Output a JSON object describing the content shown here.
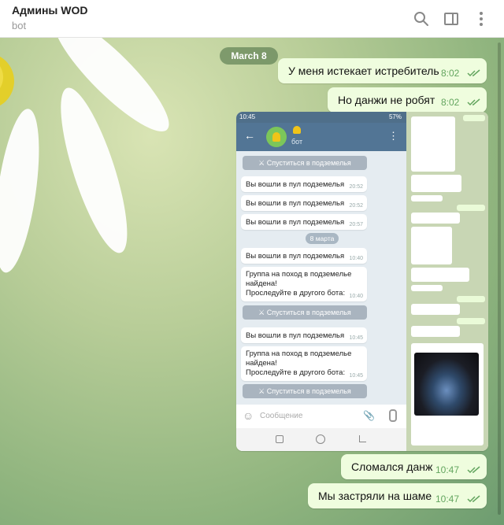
{
  "header": {
    "title": "Админы WOD",
    "subtitle": "bot"
  },
  "chat": {
    "date_label": "March 8",
    "messages": [
      {
        "text": "У меня истекает истребитель",
        "time": "8:02"
      },
      {
        "text": "Но данжи не робят",
        "time": "8:02"
      },
      {
        "text": "Сломался данж",
        "time": "10:47"
      },
      {
        "text": "Мы застряли на шаме",
        "time": "10:47"
      }
    ],
    "screenshot": {
      "status_time": "10:45",
      "battery": "57%",
      "bot_name": "бот",
      "button_label": "Спуститься в подземелья",
      "date_label": "8 марта",
      "input_placeholder": "Сообщение",
      "messages": [
        {
          "text": "Вы вошли в пул подземелья",
          "time": "20:52"
        },
        {
          "text": "Вы вошли в пул подземелья",
          "time": "20:52"
        },
        {
          "text": "Вы вошли в пул подземелья",
          "time": "20:57"
        },
        {
          "text": "Вы вошли в пул подземелья",
          "time": "10:40"
        },
        {
          "line1": "Группа на поход в подземелье",
          "line2": "найдена!",
          "line3": "Проследуйте в другого бота:",
          "time": "10:40"
        },
        {
          "text": "Вы вошли в пул подземелья",
          "time": "10:45"
        },
        {
          "line1": "Группа на поход в подземелье",
          "line2": "найдена!",
          "line3": "Проследуйте в другого бота:",
          "time": "10:45"
        }
      ]
    }
  }
}
